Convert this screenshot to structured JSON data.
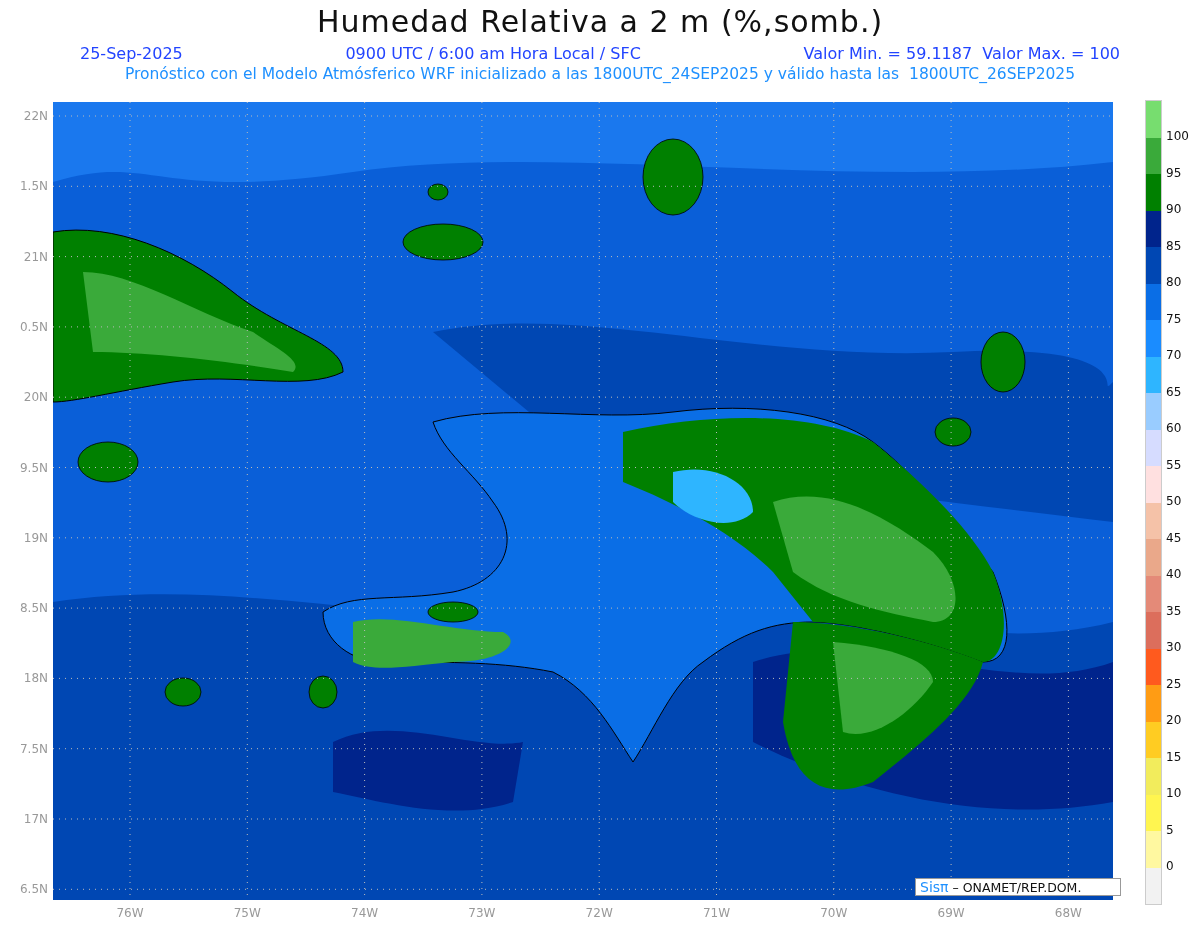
{
  "title": "Humedad Relativa a 2 m (%,somb.)",
  "info_line": {
    "date": "25-Sep-2025",
    "time": "0900 UTC / 6:00 am Hora Local / SFC",
    "range": "Valor Min. = 59.1187  Valor Max. = 100"
  },
  "model_line": "Pronóstico con el Modelo Atmósferico WRF inicializado a las 1800UTC_24SEP2025 y válido hasta las  1800UTC_26SEP2025",
  "y_axis_labels": [
    "22N",
    "1.5N",
    "21N",
    "0.5N",
    "20N",
    "9.5N",
    "19N",
    "8.5N",
    "18N",
    "7.5N",
    "17N",
    "6.5N"
  ],
  "x_axis_labels": [
    "76W",
    "75W",
    "74W",
    "73W",
    "72W",
    "71W",
    "70W",
    "69W",
    "68W"
  ],
  "legend": {
    "swatches": [
      {
        "color": "#77dd6f"
      },
      {
        "color": "#3aaa3a"
      },
      {
        "color": "#008000"
      },
      {
        "color": "#00248c"
      },
      {
        "color": "#0047b3"
      },
      {
        "color": "#0a6ee6"
      },
      {
        "color": "#1a8cff"
      },
      {
        "color": "#2eb5ff"
      },
      {
        "color": "#99ccff"
      },
      {
        "color": "#d6dcff"
      },
      {
        "color": "#ffe0e0"
      },
      {
        "color": "#f5c2a8"
      },
      {
        "color": "#eaa88a"
      },
      {
        "color": "#e48a78"
      },
      {
        "color": "#dc6e5c"
      },
      {
        "color": "#ff5a1e"
      },
      {
        "color": "#ff9c14"
      },
      {
        "color": "#ffcc22"
      },
      {
        "color": "#f2ec5c"
      },
      {
        "color": "#fff550"
      },
      {
        "color": "#fff8a0"
      },
      {
        "color": "#f2f2f2"
      }
    ],
    "labels": [
      "100",
      "95",
      "90",
      "85",
      "80",
      "75",
      "70",
      "65",
      "60",
      "55",
      "50",
      "45",
      "40",
      "35",
      "30",
      "25",
      "20",
      "15",
      "10",
      "5",
      "0"
    ]
  },
  "credit": {
    "logo": "Sisπ",
    "text": "– ONAMET/REP.DOM."
  }
}
